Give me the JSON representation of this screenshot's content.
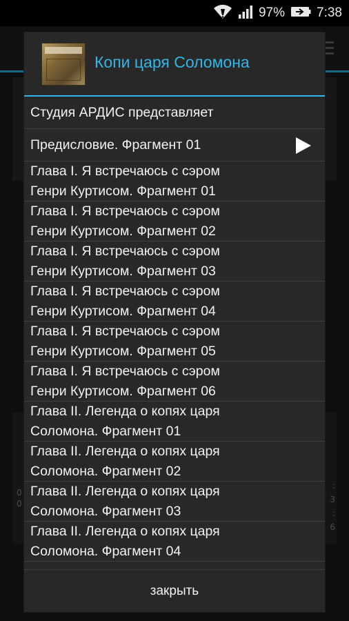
{
  "statusbar": {
    "battery_percent": "97%",
    "time": "7:38",
    "icons": [
      "wifi-icon",
      "signal-icon",
      "battery-icon"
    ]
  },
  "background": {
    "left_values": [
      "0",
      "0"
    ],
    "right_values": [
      ":",
      "3",
      ":",
      "6"
    ]
  },
  "dialog": {
    "title": "Копи царя Соломона",
    "cover": "book-cover-image",
    "items": [
      {
        "line1": "Студия АРДИС представляет",
        "line2": ""
      },
      {
        "line1": "Предисловие. Фрагмент 01",
        "line2": "",
        "playing": true
      },
      {
        "line1": "Глава I. Я встречаюсь с сэром",
        "line2": "Генри Куртисом. Фрагмент 01"
      },
      {
        "line1": "Глава I. Я встречаюсь с сэром",
        "line2": "Генри Куртисом. Фрагмент 02"
      },
      {
        "line1": "Глава I. Я встречаюсь с сэром",
        "line2": "Генри Куртисом. Фрагмент 03"
      },
      {
        "line1": "Глава I. Я встречаюсь с сэром",
        "line2": "Генри Куртисом. Фрагмент 04"
      },
      {
        "line1": "Глава I. Я встречаюсь с сэром",
        "line2": "Генри Куртисом. Фрагмент 05"
      },
      {
        "line1": "Глава I. Я встречаюсь с сэром",
        "line2": "Генри Куртисом. Фрагмент 06"
      },
      {
        "line1": "Глава II. Легенда о копях царя",
        "line2": "Соломона. Фрагмент 01"
      },
      {
        "line1": "Глава II. Легенда о копях царя",
        "line2": "Соломона. Фрагмент 02"
      },
      {
        "line1": "Глава II. Легенда о копях царя",
        "line2": "Соломона. Фрагмент 03"
      },
      {
        "line1": "Глава II. Легенда о копях царя",
        "line2": "Соломона. Фрагмент 04"
      }
    ],
    "close_label": "закрыть"
  },
  "colors": {
    "accent": "#33b5e5",
    "dialog_bg": "#282828",
    "divider": "#3e3e3e"
  }
}
